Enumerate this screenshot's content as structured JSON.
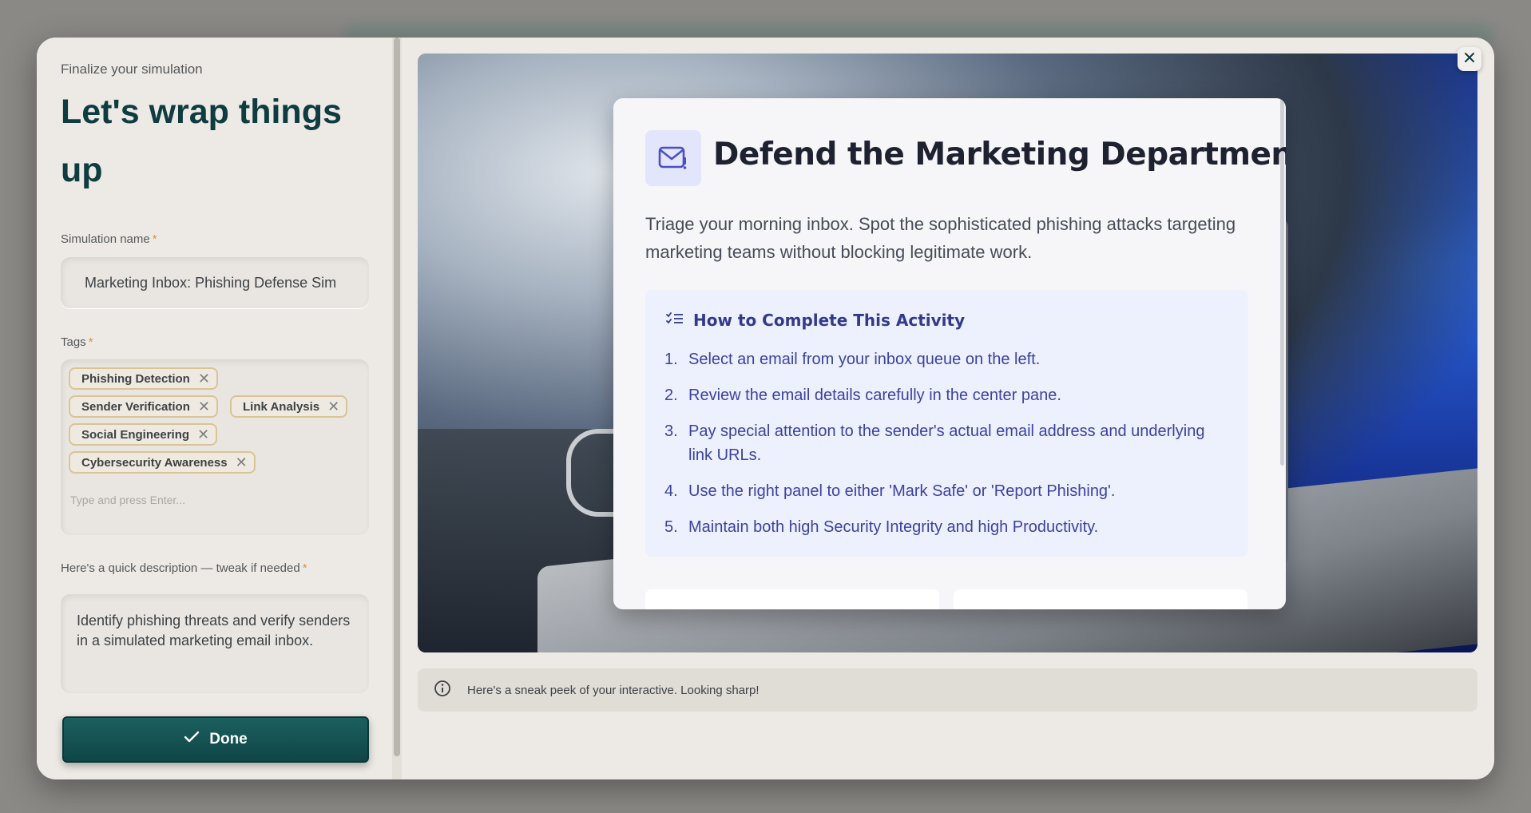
{
  "left": {
    "eyebrow": "Finalize your simulation",
    "title": "Let's wrap things up",
    "name_label": "Simulation name",
    "name_value": "Marketing Inbox: Phishing Defense Sim",
    "tags_label": "Tags",
    "tags": [
      "Phishing Detection",
      "Sender Verification",
      "Link Analysis",
      "Social Engineering",
      "Cybersecurity Awareness"
    ],
    "tags_placeholder": "Type and press Enter...",
    "desc_label": "Here's a quick description — tweak if needed",
    "desc_value": "Identify phishing threats and verify senders in a simulated marketing email inbox.",
    "done_label": "Done",
    "required_mark": "*"
  },
  "preview": {
    "card_title": "Defend the Marketing Department",
    "card_desc": "Triage your morning inbox. Spot the sophisticated phishing attacks targeting marketing teams without blocking legitimate work.",
    "how_title": "How to Complete This Activity",
    "steps": [
      "Select an email from your inbox queue on the left.",
      "Review the email details carefully in the center pane.",
      "Pay special attention to the sender's actual email address and underlying link URLs.",
      "Use the right panel to either 'Mark Safe' or 'Report Phishing'.",
      "Maintain both high Security Integrity and high Productivity."
    ],
    "step_numbers": [
      "1.",
      "2.",
      "3.",
      "4.",
      "5."
    ]
  },
  "info_bar": {
    "text": "Here's a sneak peek of your interactive. Looking sharp!"
  },
  "icons": {
    "mail_alert": "mail-alert-icon",
    "list_check": "list-check-icon",
    "check": "check-icon",
    "close": "close-icon",
    "info": "info-icon",
    "tag_remove": "x-icon"
  },
  "colors": {
    "primary": "#0f4647",
    "title": "#0f3c40",
    "tag_border": "#d9c496",
    "accent_indigo": "#3d42a0"
  }
}
